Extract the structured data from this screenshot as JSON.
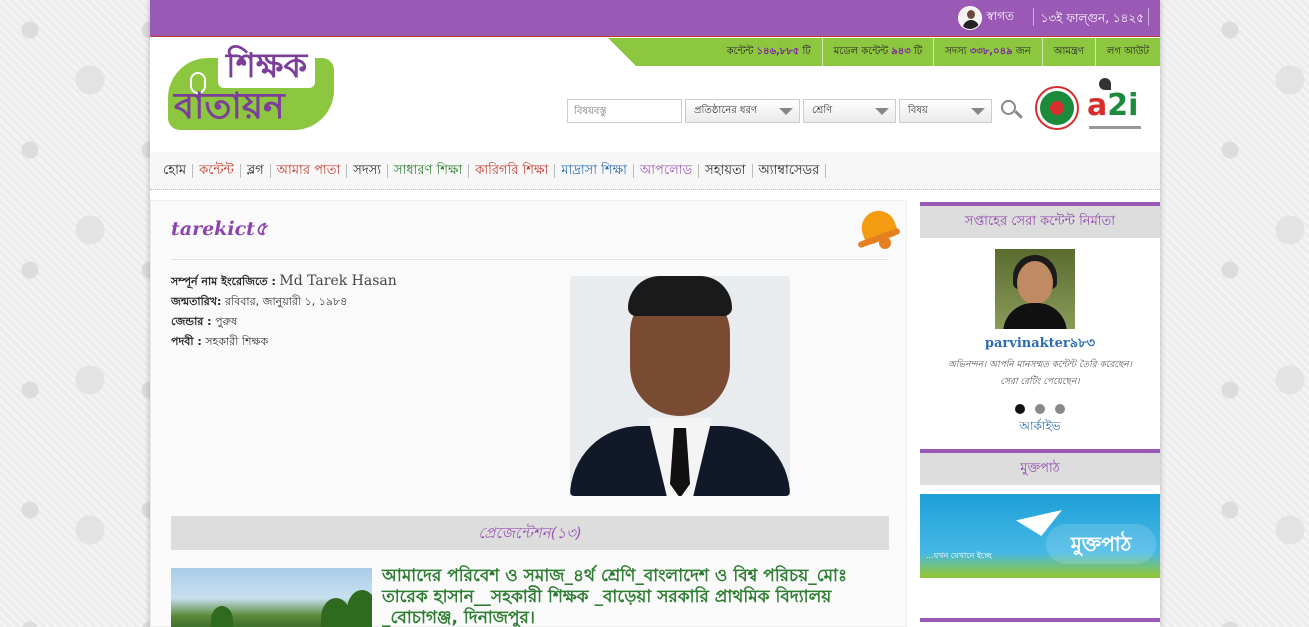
{
  "topbar": {
    "welcome_label": "স্বাগত",
    "date": "১৩ই ফাল্গুন, ১৪২৫"
  },
  "stats": [
    {
      "label": "কন্টেন্ট",
      "value": "১৪৬,৮৮৫",
      "unit": "টি"
    },
    {
      "label": "মডেল কন্টেন্ট",
      "value": "৯৪৩",
      "unit": "টি"
    },
    {
      "label": "সদস্য",
      "value": "৩৩৮,০৪৯",
      "unit": "জন"
    },
    {
      "label": "আমন্ত্রণ",
      "value": "",
      "unit": ""
    },
    {
      "label": "লগ আউট",
      "value": "",
      "unit": ""
    }
  ],
  "logo": {
    "line1": "শিক্ষক",
    "line2": "বাতায়ন"
  },
  "search": {
    "placeholder": "বিষয়বস্তু",
    "filters": [
      "প্রতিষ্ঠানের ধরণ",
      "শ্রেণি",
      "বিষয়"
    ]
  },
  "a2i": {
    "text_a": "a",
    "text_2i": "2i"
  },
  "nav": [
    {
      "label": "হোম",
      "color": "#222222"
    },
    {
      "label": "কন্টেন্ট",
      "color": "#c0392b"
    },
    {
      "label": "ব্লগ",
      "color": "#222222"
    },
    {
      "label": "আমার পাতা",
      "color": "#c0392b"
    },
    {
      "label": "সদস্য",
      "color": "#222222"
    },
    {
      "label": "সাধারণ শিক্ষা",
      "color": "#2e7d32"
    },
    {
      "label": "কারিগরি শিক্ষা",
      "color": "#c0392b"
    },
    {
      "label": "মাদ্রাসা শিক্ষা",
      "color": "#2b6cb0"
    },
    {
      "label": "আপলোড",
      "color": "#9b59b6"
    },
    {
      "label": "সহায়তা",
      "color": "#222222"
    },
    {
      "label": "অ্যাম্বাসেডর",
      "color": "#222222"
    }
  ],
  "profile": {
    "username": "tarekict৫",
    "fields": [
      {
        "label": "সম্পূর্ন নাম ইংরেজিতে :",
        "value": "Md Tarek Hasan"
      },
      {
        "label": "জন্মতারিখ:",
        "value": "রবিবার, জানুয়ারী ১, ১৯৮৪"
      },
      {
        "label": "জেন্ডার :",
        "value": "পুরুষ"
      },
      {
        "label": "পদবী :",
        "value": "সহকারী শিক্ষক"
      }
    ]
  },
  "presentations": {
    "heading": "প্রেজেন্টেশন(১৩)",
    "first_post_title": "আমাদের পরিবেশ ও সমাজ_৪র্থ শ্রেণি_বাংলাদেশ ও বিশ্ব পরিচয়_মোঃ তারেক হাসান__সহকারী শিক্ষক _বাড়েয়া সরকারি প্রাথমিক বিদ্যালয় _বোচাগঞ্জ, দিনাজপুর।"
  },
  "sidebar": {
    "top_maker_heading": "সপ্তাহের সেরা কন্টেন্ট নির্মাতা",
    "maker_name": "parvinakter৯৮৩",
    "maker_message_line1": "অভিনন্দন। আপনি মানসম্মত কন্টেন্ট তৈরি করেছেন।",
    "maker_message_line2": "সেরা রেটিং পেয়েছেন।",
    "archive_label": "আর্কাইভ",
    "muktopath_heading": "মুক্তপাঠ",
    "muktopath_brand": "মুক্তপাঠ",
    "muktopath_tagline": "...যখন যেখানে ইচ্ছে"
  },
  "colors": {
    "purple": "#9b59b6",
    "green": "#8dc63f",
    "post_title": "#2e7d32"
  }
}
